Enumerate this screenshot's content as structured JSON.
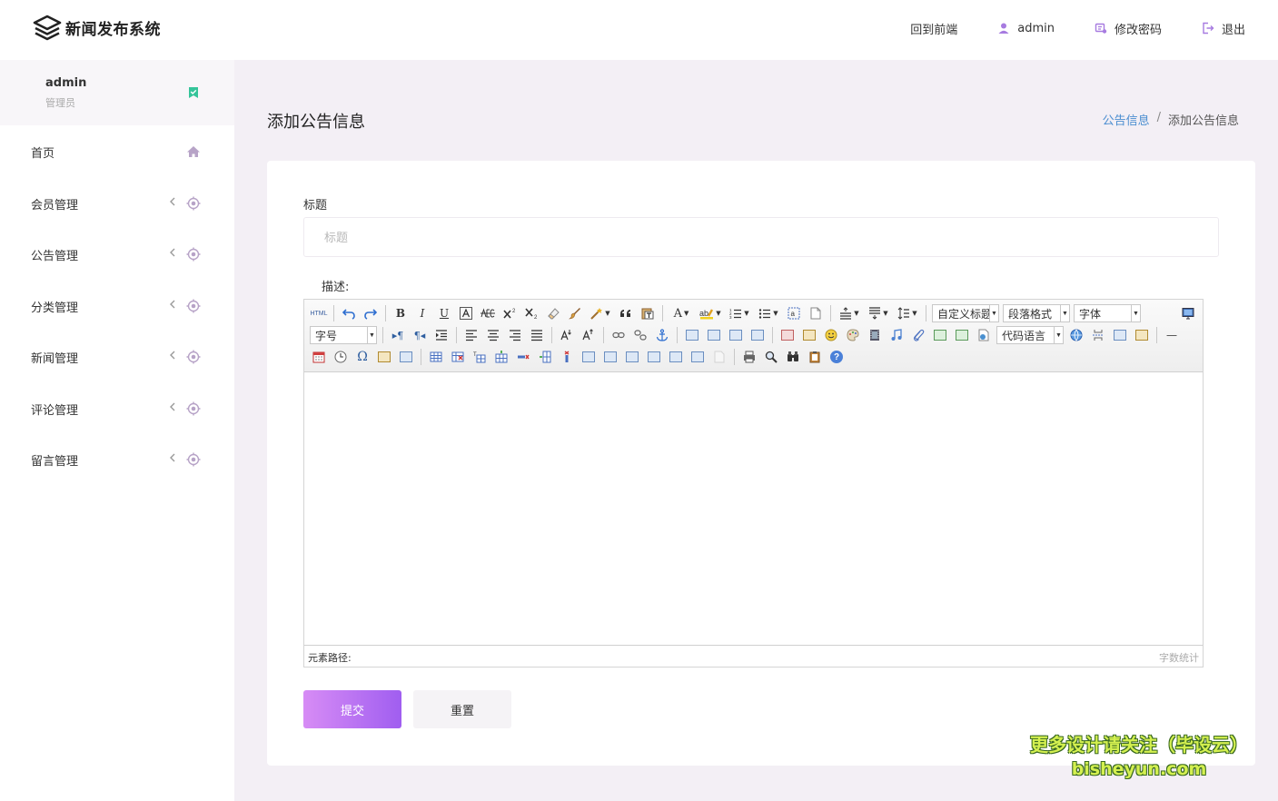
{
  "app": {
    "title": "新闻发布系统"
  },
  "topnav": {
    "front_label": "回到前端",
    "user_label": "admin",
    "password_label": "修改密码",
    "logout_label": "退出"
  },
  "sidebar": {
    "user": {
      "name": "admin",
      "role": "管理员"
    },
    "items": [
      {
        "label": "首页"
      },
      {
        "label": "会员管理"
      },
      {
        "label": "公告管理"
      },
      {
        "label": "分类管理"
      },
      {
        "label": "新闻管理"
      },
      {
        "label": "评论管理"
      },
      {
        "label": "留言管理"
      }
    ]
  },
  "main": {
    "page_title": "添加公告信息",
    "breadcrumb": {
      "parent": "公告信息",
      "separator": "/",
      "current": "添加公告信息"
    },
    "form": {
      "title_label": "标题",
      "title_placeholder": "标题",
      "title_value": "",
      "desc_label": "描述:"
    },
    "editor": {
      "selects": {
        "custom_heading": "自定义标题",
        "paragraph": "段落格式",
        "font_family": "字体",
        "font_size": "字号",
        "code_lang": "代码语言"
      },
      "tool_labels": {
        "html": "HTML",
        "bold": "B",
        "italic": "I",
        "underline": "U",
        "font_color": "A",
        "hr": "—",
        "help": "?"
      },
      "status_path": "元素路径:",
      "word_count": "字数统计"
    },
    "buttons": {
      "submit": "提交",
      "reset": "重置"
    }
  },
  "watermark": {
    "line1": "更多设计请关注（毕设云）",
    "line2": "bisheyun.com"
  },
  "colors": {
    "accent": "#a05ef0",
    "accent_light": "#d78cf5",
    "link": "#4a8dd0",
    "check": "#35c49a",
    "background": "#f3eff5"
  }
}
